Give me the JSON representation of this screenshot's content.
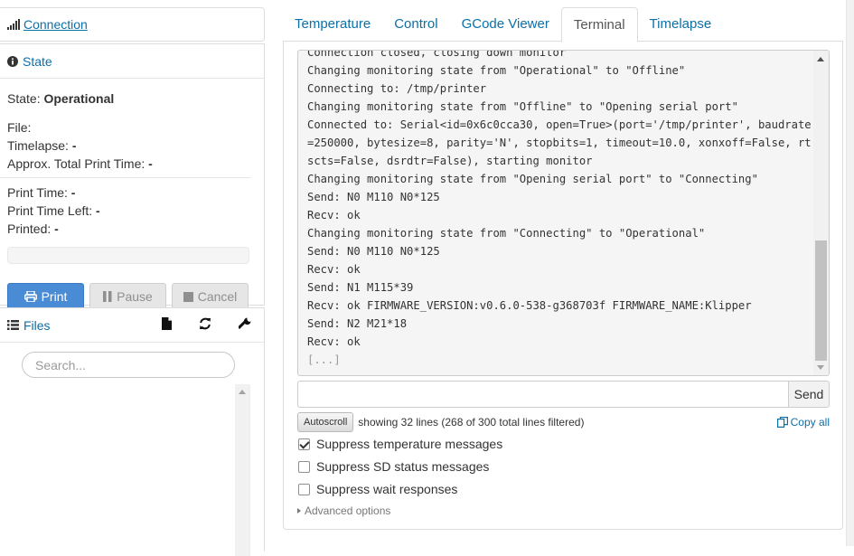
{
  "sidebar": {
    "connection": {
      "label": "Connection"
    },
    "state": {
      "title": "State",
      "state_label": "State:",
      "state_value": "Operational",
      "file_label": "File:",
      "timelapse_label": "Timelapse:",
      "timelapse_value": "-",
      "approx_label": "Approx. Total Print Time:",
      "approx_value": "-",
      "print_time_label": "Print Time:",
      "print_time_value": "-",
      "print_time_left_label": "Print Time Left:",
      "print_time_left_value": "-",
      "printed_label": "Printed:",
      "printed_value": "-",
      "progress_fraction": 0,
      "buttons": {
        "print": "Print",
        "pause": "Pause",
        "cancel": "Cancel"
      }
    },
    "files": {
      "title": "Files",
      "search_placeholder": "Search..."
    }
  },
  "tabs": [
    {
      "label": "Temperature",
      "active": false
    },
    {
      "label": "Control",
      "active": false
    },
    {
      "label": "GCode Viewer",
      "active": false
    },
    {
      "label": "Terminal",
      "active": true
    },
    {
      "label": "Timelapse",
      "active": false
    }
  ],
  "terminal": {
    "lines": [
      "Connection closed, closing down monitor",
      "Changing monitoring state from \"Operational\" to \"Offline\"",
      "Connecting to: /tmp/printer",
      "Changing monitoring state from \"Offline\" to \"Opening serial port\"",
      "Connected to: Serial<id=0x6c0cca30, open=True>(port='/tmp/printer', baudrate",
      "=250000, bytesize=8, parity='N', stopbits=1, timeout=10.0, xonxoff=False, rt",
      "scts=False, dsrdtr=False), starting monitor",
      "Changing monitoring state from \"Opening serial port\" to \"Connecting\"",
      "Send: N0 M110 N0*125",
      "Recv: ok",
      "Changing monitoring state from \"Connecting\" to \"Operational\"",
      "Send: N0 M110 N0*125",
      "Recv: ok",
      "Send: N1 M115*39",
      "Recv: ok FIRMWARE_VERSION:v0.6.0-538-g368703f FIRMWARE_NAME:Klipper",
      "Send: N2 M21*18",
      "Recv: ok"
    ],
    "ellipsis": "[...]",
    "command_value": "",
    "send_label": "Send",
    "autoscroll_label": "Autoscroll",
    "showing_text": "showing 32 lines (268 of 300 total lines filtered)",
    "copy_all_label": "Copy all",
    "suppress_temperature": {
      "label": "Suppress temperature messages",
      "checked": true
    },
    "suppress_sd": {
      "label": "Suppress SD status messages",
      "checked": false
    },
    "suppress_wait": {
      "label": "Suppress wait responses",
      "checked": false
    },
    "advanced_label": "Advanced options"
  },
  "colors": {
    "link": "#0c6fa8",
    "print_button": "#4a8bd6",
    "terminal_bg": "#f5f5f5"
  }
}
